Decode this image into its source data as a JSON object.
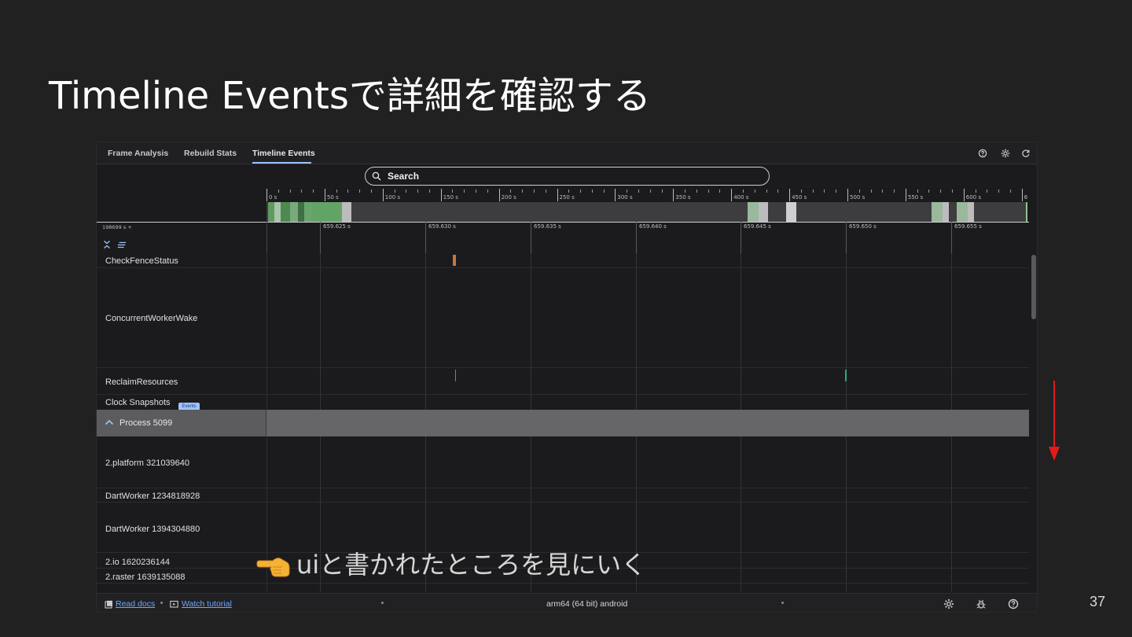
{
  "slide": {
    "title": "Timeline Eventsで詳細を確認する",
    "page_number": "37",
    "annotation": "uiと書かれたところを見にいく"
  },
  "devtools": {
    "tabs": [
      {
        "label": "Frame Analysis",
        "active": false
      },
      {
        "label": "Rebuild Stats",
        "active": false
      },
      {
        "label": "Timeline Events",
        "active": true
      }
    ],
    "toolbar_icons": [
      "help-icon",
      "gear-icon",
      "refresh-icon"
    ],
    "search": {
      "placeholder": "Search",
      "value": ""
    },
    "overview": {
      "tick_labels": [
        "0 s",
        "50 s",
        "100 s",
        "150 s",
        "200 s",
        "250 s",
        "300 s",
        "350 s",
        "400 s",
        "450 s",
        "500 s",
        "550 s",
        "600 s",
        "6"
      ]
    },
    "time_ruler": {
      "base": "198699 s +",
      "ticks": [
        "659.625 s",
        "659.630 s",
        "659.635 s",
        "659.640 s",
        "659.645 s",
        "659.650 s",
        "659.655 s"
      ]
    },
    "tracks": [
      {
        "label": "CheckFenceStatus"
      },
      {
        "label": "ConcurrentWorkerWake"
      },
      {
        "label": "ReclaimResources"
      },
      {
        "label": "Clock Snapshots",
        "badge": "Events"
      },
      {
        "label": "Process 5099",
        "group": true
      },
      {
        "label": "2.platform 321039640"
      },
      {
        "label": "DartWorker 1234818928"
      },
      {
        "label": "DartWorker 1394304880"
      },
      {
        "label": "2.io 1620236144"
      },
      {
        "label": "2.raster 1639135088"
      }
    ],
    "bottom_bar": {
      "read_docs": "Read docs",
      "watch_tutorial": "Watch tutorial",
      "device": "arm64 (64 bit) android"
    },
    "colors": {
      "accent": "#9ec3ff",
      "event_orange": "#c7773f",
      "event_teal": "#2aa889",
      "annotation_arrow": "#e21b1b"
    }
  }
}
